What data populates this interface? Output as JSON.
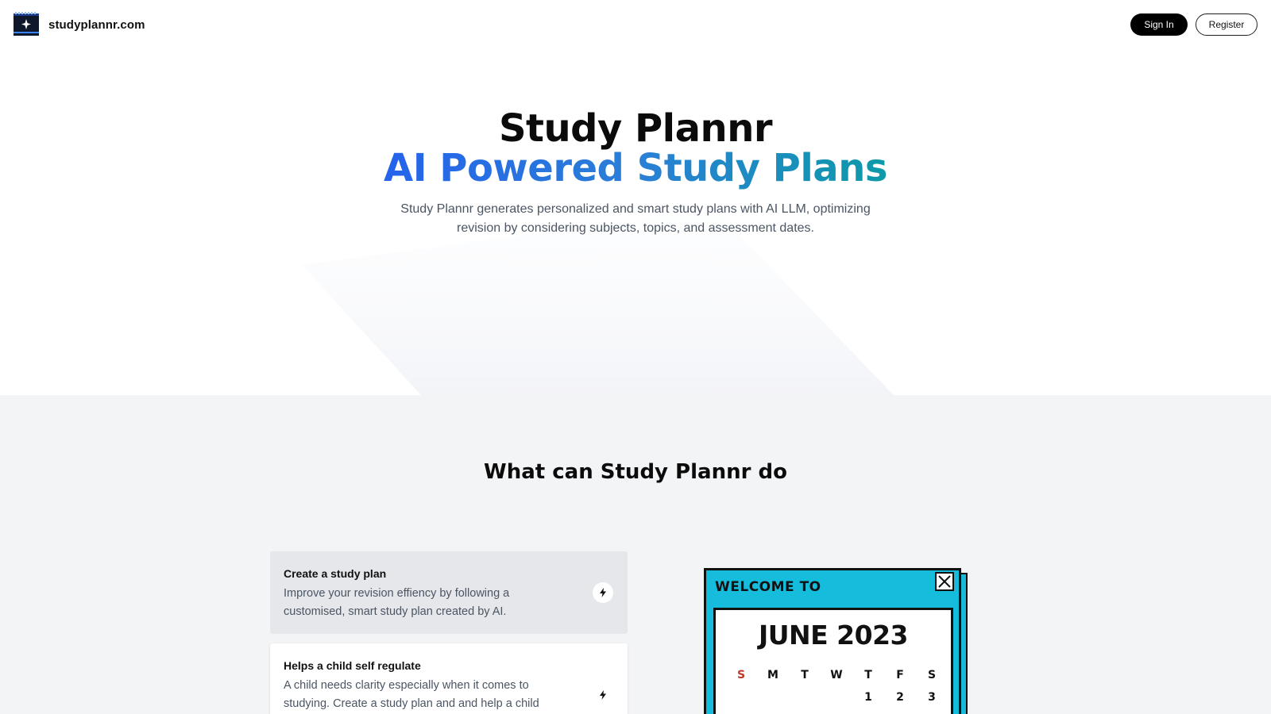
{
  "header": {
    "brand": "studyplannr.com",
    "logo_icon": "calendar-sparkle-icon",
    "signin_label": "Sign In",
    "register_label": "Register"
  },
  "hero": {
    "title": "Study Plannr",
    "subtitle": "AI Powered Study Plans",
    "description": "Study Plannr generates personalized and smart study plans with AI LLM, optimizing revision by considering subjects, topics, and assessment dates.",
    "gradient_colors": [
      "#2563eb",
      "#0d9aa8"
    ]
  },
  "features": {
    "title": "What can Study Plannr do",
    "cards": [
      {
        "title": "Create a study plan",
        "text": "Improve your revision effiency by following a customised, smart study plan created by AI.",
        "icon": "lightning-icon"
      },
      {
        "title": "Helps a child self regulate",
        "text": "A child needs clarity especially when it comes to studying. Create a study plan and and help a child with",
        "icon": "lightning-icon"
      }
    ]
  },
  "calendar": {
    "welcome": "Welcome to",
    "month": "JUNE 2023",
    "days": [
      "S",
      "M",
      "T",
      "W",
      "T",
      "F",
      "S"
    ],
    "first_row": [
      "",
      "",
      "",
      "",
      "1",
      "2",
      "3"
    ],
    "accent_color": "#15bcdc"
  }
}
